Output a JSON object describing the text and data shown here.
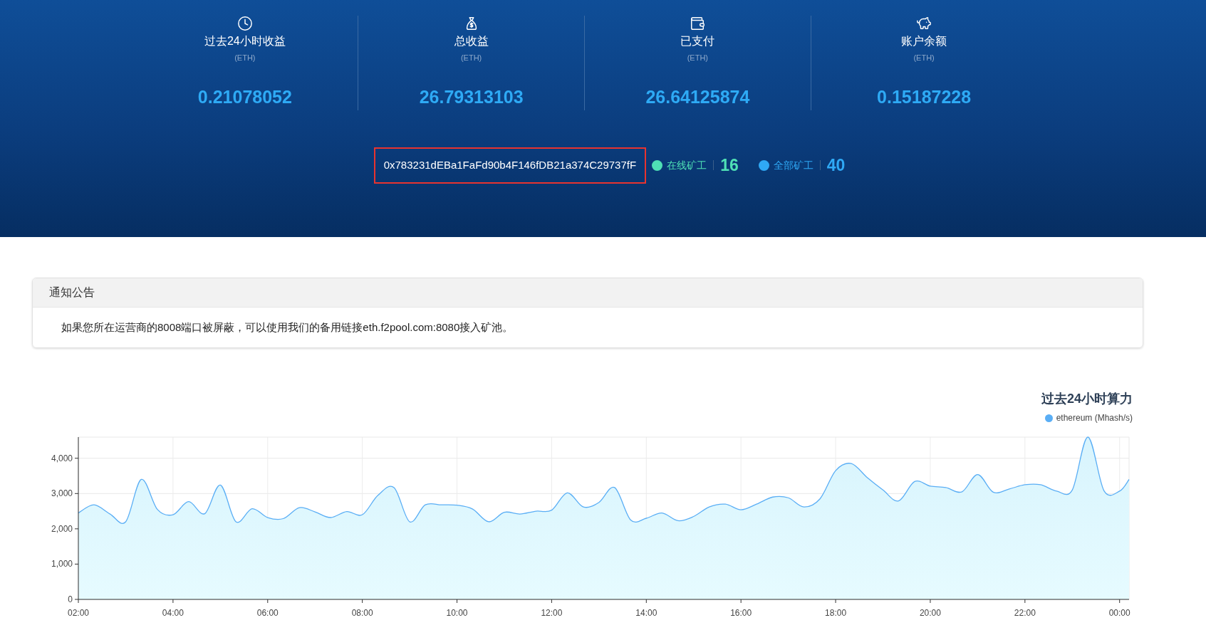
{
  "stats": [
    {
      "kind": "clock",
      "label": "过去24小时收益",
      "unit": "(ETH)",
      "value": "0.21078052"
    },
    {
      "kind": "moneybag",
      "label": "总收益",
      "unit": "(ETH)",
      "value": "26.79313103"
    },
    {
      "kind": "wallet",
      "label": "已支付",
      "unit": "(ETH)",
      "value": "26.64125874"
    },
    {
      "kind": "piggy",
      "label": "账户余额",
      "unit": "(ETH)",
      "value": "0.15187228"
    }
  ],
  "address": "0x783231dEBa1FaFd90b4F146fDB21a374C29737fF",
  "workers": [
    {
      "label": "在线矿工",
      "count": "16",
      "color": "#4fe0b5"
    },
    {
      "label": "全部矿工",
      "count": "40",
      "color": "#2fa9f5"
    }
  ],
  "notice": {
    "title": "通知公告",
    "text": "如果您所在运营商的8008端口被屏蔽，可以使用我们的备用链接eth.f2pool.com:8080接入矿池。"
  },
  "hashrate": {
    "chart_data": {
      "type": "area",
      "grid": true,
      "title": "过去24小时算力",
      "xlim": [
        2,
        24.2
      ],
      "ylim": [
        0,
        4600
      ],
      "yticks": [
        {
          "value": 0,
          "label": "0"
        },
        {
          "value": 1000,
          "label": "1,000"
        },
        {
          "value": 2000,
          "label": "2,000"
        },
        {
          "value": 3000,
          "label": "3,000"
        },
        {
          "value": 4000,
          "label": "4,000"
        }
      ],
      "xticks": [
        {
          "value": 2,
          "label": "02:00"
        },
        {
          "value": 4,
          "label": "04:00"
        },
        {
          "value": 6,
          "label": "06:00"
        },
        {
          "value": 8,
          "label": "08:00"
        },
        {
          "value": 10,
          "label": "10:00"
        },
        {
          "value": 12,
          "label": "12:00"
        },
        {
          "value": 14,
          "label": "14:00"
        },
        {
          "value": 16,
          "label": "16:00"
        },
        {
          "value": 18,
          "label": "18:00"
        },
        {
          "value": 20,
          "label": "20:00"
        },
        {
          "value": 22,
          "label": "22:00"
        },
        {
          "value": 24,
          "label": "00:00"
        }
      ],
      "x": [
        2,
        2.33,
        2.67,
        3,
        3.33,
        3.67,
        4,
        4.33,
        4.67,
        5,
        5.33,
        5.67,
        6,
        6.33,
        6.67,
        7,
        7.33,
        7.67,
        8,
        8.33,
        8.67,
        9,
        9.33,
        9.67,
        10,
        10.33,
        10.67,
        11,
        11.33,
        11.67,
        12,
        12.33,
        12.67,
        13,
        13.33,
        13.67,
        14,
        14.33,
        14.67,
        15,
        15.33,
        15.67,
        16,
        16.33,
        16.67,
        17,
        17.33,
        17.67,
        18,
        18.33,
        18.67,
        19,
        19.33,
        19.67,
        20,
        20.33,
        20.67,
        21,
        21.33,
        21.67,
        22,
        22.33,
        22.67,
        23,
        23.33,
        23.67,
        24,
        24.2
      ],
      "series": [
        {
          "name": "ethereum (Mhash/s)",
          "color": "#5aaef5",
          "values": [
            2450,
            2680,
            2420,
            2200,
            3400,
            2550,
            2400,
            2770,
            2430,
            3240,
            2200,
            2570,
            2320,
            2290,
            2600,
            2480,
            2320,
            2490,
            2400,
            2950,
            3170,
            2200,
            2680,
            2680,
            2670,
            2560,
            2200,
            2470,
            2420,
            2500,
            2530,
            3020,
            2620,
            2750,
            3170,
            2250,
            2300,
            2450,
            2230,
            2350,
            2620,
            2700,
            2540,
            2700,
            2900,
            2880,
            2620,
            2850,
            3650,
            3850,
            3450,
            3100,
            2790,
            3340,
            3210,
            3170,
            3050,
            3540,
            3040,
            3130,
            3250,
            3250,
            3070,
            3100,
            4600,
            3080,
            3070,
            3400
          ]
        }
      ]
    }
  }
}
